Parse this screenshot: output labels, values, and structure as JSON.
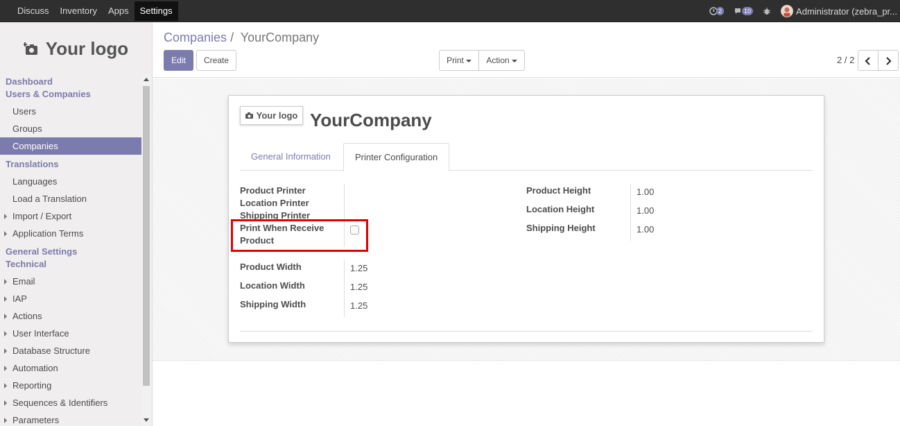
{
  "topbar": {
    "apps": [
      {
        "label": "Discuss"
      },
      {
        "label": "Inventory"
      },
      {
        "label": "Apps"
      },
      {
        "label": "Settings"
      }
    ],
    "activity_count": "2",
    "messages_count": "10",
    "user_name": "Administrator (zebra_pr..."
  },
  "sidebar": {
    "logo_text": "Your logo",
    "sections": {
      "dashboard": "Dashboard",
      "users_companies": "Users & Companies",
      "users": "Users",
      "groups": "Groups",
      "companies": "Companies",
      "translations": "Translations",
      "languages": "Languages",
      "load_translation": "Load a Translation",
      "import_export": "Import / Export",
      "application_terms": "Application Terms",
      "general_settings": "General Settings",
      "technical": "Technical",
      "email": "Email",
      "iap": "IAP",
      "actions": "Actions",
      "user_interface": "User Interface",
      "database_structure": "Database Structure",
      "automation": "Automation",
      "reporting": "Reporting",
      "sequences": "Sequences & Identifiers",
      "parameters": "Parameters"
    }
  },
  "control_panel": {
    "breadcrumb_parent": "Companies",
    "breadcrumb_sep": "/",
    "breadcrumb_current": "YourCompany",
    "edit_label": "Edit",
    "create_label": "Create",
    "print_label": "Print",
    "action_label": "Action",
    "pager": "2 / 2"
  },
  "form": {
    "logo_text": "Your logo",
    "company_name": "YourCompany",
    "tabs": {
      "general": "General Information",
      "printer": "Printer Configuration"
    },
    "fields": {
      "product_printer": "Product Printer",
      "location_printer": "Location Printer",
      "shipping_printer": "Shipping Printer",
      "print_when_receive_1": "Print When Receive",
      "print_when_receive_2": "Product",
      "product_width": "Product Width",
      "location_width": "Location Width",
      "shipping_width": "Shipping Width",
      "product_width_val": "1.25",
      "location_width_val": "1.25",
      "shipping_width_val": "1.25",
      "product_height": "Product Height",
      "location_height": "Location Height",
      "shipping_height": "Shipping Height",
      "product_height_val": "1.00",
      "location_height_val": "1.00",
      "shipping_height_val": "1.00"
    },
    "print_when_receive_checked": false
  },
  "colors": {
    "accent": "#7c7bad",
    "highlight": "#e00000",
    "navbar": "#2f2f2f"
  }
}
